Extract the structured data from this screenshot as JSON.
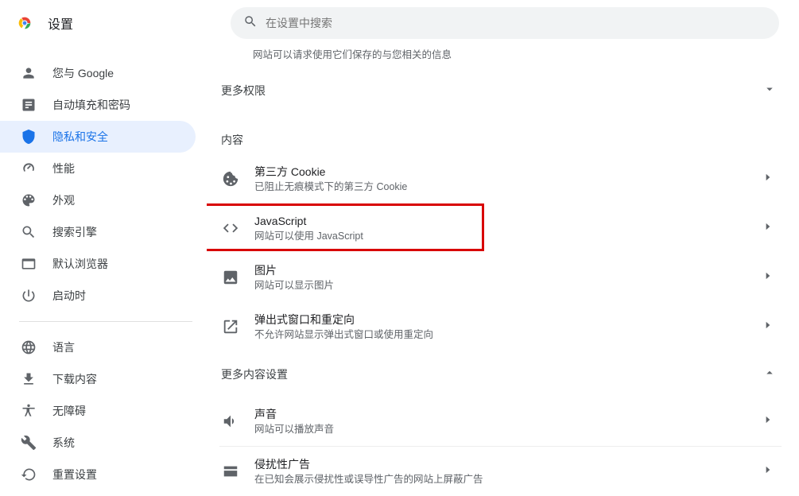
{
  "header": {
    "title": "设置",
    "search_placeholder": "在设置中搜索"
  },
  "sidebar": {
    "items": [
      {
        "id": "you-and-google",
        "label": "您与 Google"
      },
      {
        "id": "autofill",
        "label": "自动填充和密码"
      },
      {
        "id": "privacy",
        "label": "隐私和安全"
      },
      {
        "id": "performance",
        "label": "性能"
      },
      {
        "id": "appearance",
        "label": "外观"
      },
      {
        "id": "search-engine",
        "label": "搜索引擎"
      },
      {
        "id": "default-browser",
        "label": "默认浏览器"
      },
      {
        "id": "on-startup",
        "label": "启动时"
      }
    ],
    "items2": [
      {
        "id": "language",
        "label": "语言"
      },
      {
        "id": "downloads",
        "label": "下载内容"
      },
      {
        "id": "accessibility",
        "label": "无障碍"
      },
      {
        "id": "system",
        "label": "系统"
      },
      {
        "id": "reset",
        "label": "重置设置"
      }
    ]
  },
  "main": {
    "truncated_sub": "网站可以请求使用它们保存的与您相关的信息",
    "more_permissions": "更多权限",
    "content_heading": "内容",
    "items": [
      {
        "title": "第三方 Cookie",
        "sub": "已阻止无痕模式下的第三方 Cookie"
      },
      {
        "title": "JavaScript",
        "sub": "网站可以使用 JavaScript"
      },
      {
        "title": "图片",
        "sub": "网站可以显示图片"
      },
      {
        "title": "弹出式窗口和重定向",
        "sub": "不允许网站显示弹出式窗口或使用重定向"
      }
    ],
    "more_content": "更多内容设置",
    "items2": [
      {
        "title": "声音",
        "sub": "网站可以播放声音"
      },
      {
        "title": "侵扰性广告",
        "sub": "在已知会展示侵扰性或误导性广告的网站上屏蔽广告"
      }
    ]
  }
}
